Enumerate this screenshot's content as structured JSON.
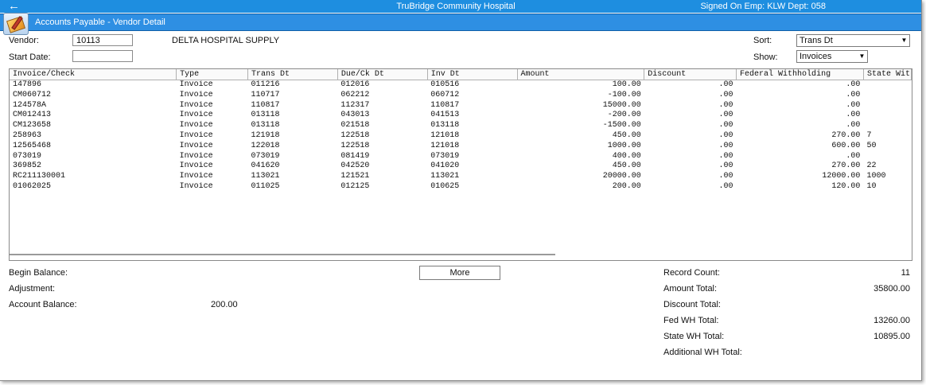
{
  "topbar": {
    "back_icon": "back-arrow-icon",
    "hospital": "TruBridge Community Hospital",
    "signed_on": "Signed On Emp: KLW  Dept: 058"
  },
  "titlebar": {
    "title": "Accounts Payable - Vendor Detail",
    "icon": "app-folder-icon"
  },
  "form": {
    "vendor_label": "Vendor:",
    "vendor_value": "10113",
    "vendor_name": "DELTA HOSPITAL SUPPLY",
    "start_date_label": "Start Date:",
    "start_date_value": "",
    "sort_label": "Sort:",
    "sort_value": "Trans Dt",
    "show_label": "Show:",
    "show_value": "Invoices"
  },
  "grid": {
    "headers": [
      "Invoice/Check",
      "Type",
      "Trans Dt",
      "Due/Ck Dt",
      "Inv Dt",
      "Amount",
      "Discount",
      "Federal Withholding",
      "State Wit"
    ],
    "rows": [
      [
        "147896",
        "Invoice",
        "011216",
        "012016",
        "010516",
        "100.00",
        ".00",
        ".00",
        ""
      ],
      [
        "CM060712",
        "Invoice",
        "110717",
        "062212",
        "060712",
        "-100.00",
        ".00",
        ".00",
        ""
      ],
      [
        "124578A",
        "Invoice",
        "110817",
        "112317",
        "110817",
        "15000.00",
        ".00",
        ".00",
        ""
      ],
      [
        "CM012413",
        "Invoice",
        "013118",
        "043013",
        "041513",
        "-200.00",
        ".00",
        ".00",
        ""
      ],
      [
        "CM123658",
        "Invoice",
        "013118",
        "021518",
        "013118",
        "-1500.00",
        ".00",
        ".00",
        ""
      ],
      [
        "258963",
        "Invoice",
        "121918",
        "122518",
        "121018",
        "450.00",
        ".00",
        "270.00",
        "7"
      ],
      [
        "12565468",
        "Invoice",
        "122018",
        "122518",
        "121018",
        "1000.00",
        ".00",
        "600.00",
        "50"
      ],
      [
        "073019",
        "Invoice",
        "073019",
        "081419",
        "073019",
        "400.00",
        ".00",
        ".00",
        ""
      ],
      [
        "369852",
        "Invoice",
        "041620",
        "042520",
        "041020",
        "450.00",
        ".00",
        "270.00",
        "22"
      ],
      [
        "RC211130001",
        "Invoice",
        "113021",
        "121521",
        "113021",
        "20000.00",
        ".00",
        "12000.00",
        "1000"
      ],
      [
        "01062025",
        "Invoice",
        "011025",
        "012125",
        "010625",
        "200.00",
        ".00",
        "120.00",
        "10"
      ]
    ]
  },
  "summary_left": {
    "begin_balance_label": "Begin Balance:",
    "adjustment_label": "Adjustment:",
    "account_balance_label": "Account Balance:",
    "account_balance_value": "200.00"
  },
  "more_button": "More",
  "summary_right": {
    "record_count_label": "Record Count:",
    "record_count_value": "11",
    "amount_total_label": "Amount Total:",
    "amount_total_value": "35800.00",
    "discount_total_label": "Discount Total:",
    "fed_wh_total_label": "Fed WH Total:",
    "fed_wh_total_value": "13260.00",
    "state_wh_total_label": "State WH Total:",
    "state_wh_total_value": "10895.00",
    "additional_wh_total_label": "Additional WH Total:"
  }
}
